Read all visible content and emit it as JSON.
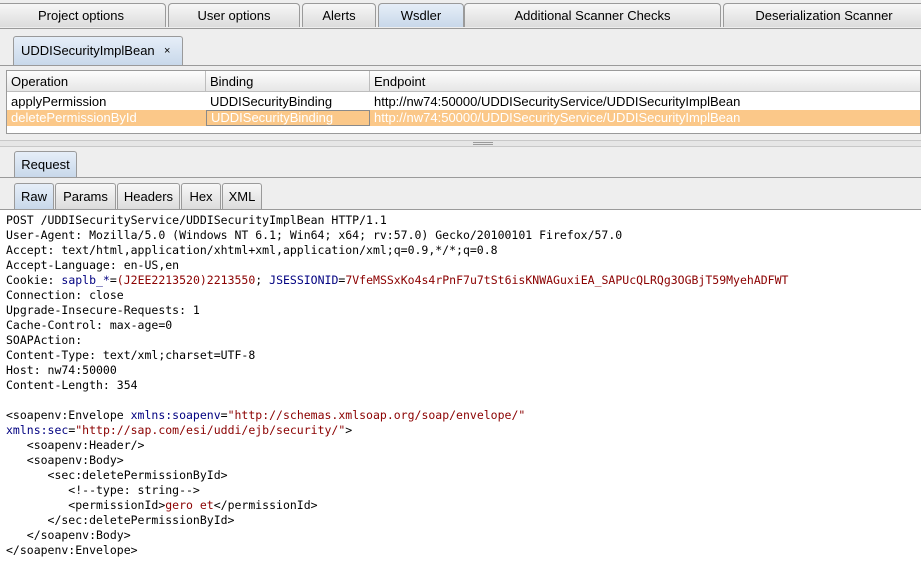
{
  "top_tabs": [
    "Project options",
    "User options",
    "Alerts",
    "Wsdler",
    "Additional Scanner Checks",
    "Deserialization Scanner"
  ],
  "active_top_tab": "Wsdler",
  "subtab": {
    "label": "UDDISecurityImplBean",
    "close_glyph": "×"
  },
  "table": {
    "headers": [
      "Operation",
      "Binding",
      "Endpoint"
    ],
    "rows": [
      {
        "operation": "applyPermission",
        "binding": "UDDISecurityBinding",
        "endpoint": "http://nw74:50000/UDDISecurityService/UDDISecurityImplBean",
        "selected": false
      },
      {
        "operation": "deletePermissionById",
        "binding": "UDDISecurityBinding",
        "endpoint": "http://nw74:50000/UDDISecurityService/UDDISecurityImplBean",
        "selected": true
      }
    ],
    "selection_color": "#fbc889"
  },
  "request_tab": "Request",
  "view_tabs": [
    "Raw",
    "Params",
    "Headers",
    "Hex",
    "XML"
  ],
  "active_view_tab": "Raw",
  "request": {
    "request_line": "POST /UDDISecurityService/UDDISecurityImplBean HTTP/1.1",
    "user_agent": "User-Agent: Mozilla/5.0 (Windows NT 6.1; Win64; x64; rv:57.0) Gecko/20100101 Firefox/57.0",
    "accept": "Accept: text/html,application/xhtml+xml,application/xml;q=0.9,*/*;q=0.8",
    "accept_language": "Accept-Language: en-US,en",
    "cookie_label": "Cookie: ",
    "cookie1_name": "saplb_*",
    "cookie1_value": "(J2EE2213520)2213550",
    "cookie2_name": "JSESSIONID",
    "cookie2_value": "7VfeMSSxKo4s4rPnF7u7tSt6isKNWAGuxiEA_SAPUcQLRQg3OGBjT59MyehADFWT",
    "connection": "Connection: close",
    "upgrade": "Upgrade-Insecure-Requests: 1",
    "cache_control": "Cache-Control: max-age=0",
    "soapaction": "SOAPAction:",
    "content_type": "Content-Type: text/xml;charset=UTF-8",
    "host": "Host: nw74:50000",
    "content_length": "Content-Length: 354",
    "envelope_tag": "<soapenv:Envelope ",
    "ns1_attr": "xmlns:soapenv",
    "ns1_value": "\"http://schemas.xmlsoap.org/soap/envelope/\"",
    "ns2_attr": "xmlns:sec",
    "ns2_value": "\"http://sap.com/esi/uddi/ejb/security/\"",
    "ns2_close": ">",
    "header_line": "   <soapenv:Header/>",
    "body_line": "   <soapenv:Body>",
    "op_open": "      <sec:deletePermissionById>",
    "comment_line": "         <!--type: string-->",
    "perm_open": "         <permissionId>",
    "perm_value": "gero et",
    "perm_close": "</permissionId>",
    "op_close": "      </sec:deletePermissionById>",
    "body_close": "   </soapenv:Body>",
    "envelope_close": "</soapenv:Envelope>"
  }
}
